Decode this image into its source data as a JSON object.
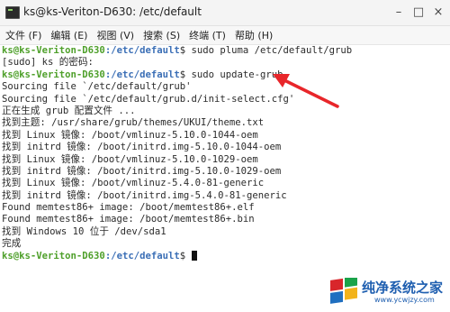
{
  "window": {
    "title": "ks@ks-Veriton-D630: /etc/default",
    "minimize_glyph": "–",
    "maximize_glyph": "□",
    "close_glyph": "×"
  },
  "menu": [
    "文件 (F)",
    "编辑 (E)",
    "视图 (V)",
    "搜索 (S)",
    "终端 (T)",
    "帮助 (H)"
  ],
  "terminal": {
    "prompt_user": "ks@ks-Veriton-D630",
    "prompt_path": ":/etc/default",
    "prompt_symbol": "$ ",
    "commands": [
      "sudo pluma /etc/default/grub",
      "sudo update-grub"
    ],
    "sudo_prompt": "[sudo] ks 的密码:",
    "output": [
      "Sourcing file `/etc/default/grub'",
      "Sourcing file `/etc/default/grub.d/init-select.cfg'",
      "正在生成 grub 配置文件 ...",
      "找到主题: /usr/share/grub/themes/UKUI/theme.txt",
      "找到 Linux 镜像: /boot/vmlinuz-5.10.0-1044-oem",
      "找到 initrd 镜像: /boot/initrd.img-5.10.0-1044-oem",
      "找到 Linux 镜像: /boot/vmlinuz-5.10.0-1029-oem",
      "找到 initrd 镜像: /boot/initrd.img-5.10.0-1029-oem",
      "找到 Linux 镜像: /boot/vmlinuz-5.4.0-81-generic",
      "找到 initrd 镜像: /boot/initrd.img-5.4.0-81-generic",
      "Found memtest86+ image: /boot/memtest86+.elf",
      "Found memtest86+ image: /boot/memtest86+.bin",
      "找到 Windows 10 位于 /dev/sda1",
      "完成"
    ]
  },
  "annotation": {
    "arrow_color": "#e8262a"
  },
  "watermark": {
    "text": "纯净系统之家",
    "url": "www.ycwjzy.com"
  }
}
